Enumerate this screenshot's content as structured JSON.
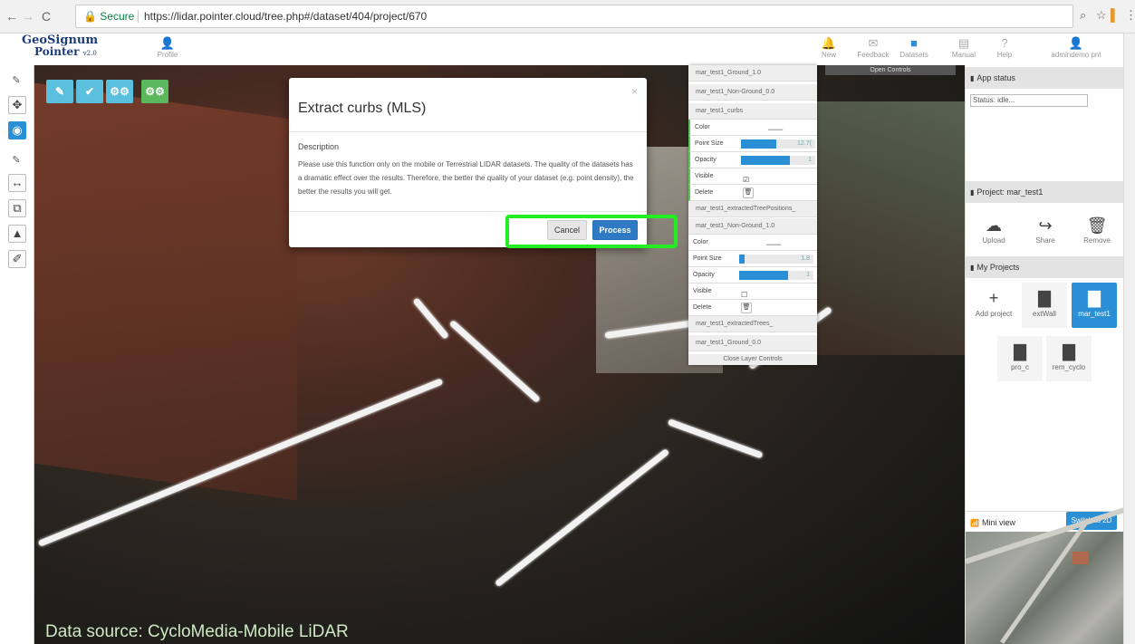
{
  "browser": {
    "secure_label": "Secure",
    "url": "https://lidar.pointer.cloud/tree.php#/dataset/404/project/670",
    "icons": [
      "back-arrow-icon",
      "forward-arrow-icon",
      "reload-icon",
      "lock-icon",
      "zoom-icon",
      "star-icon",
      "extension-icon",
      "menu-icon"
    ]
  },
  "header": {
    "logo_line1": "GeoSignum",
    "logo_line2": "Pointer",
    "logo_version": "v2.0",
    "profile_label": "Profile",
    "nav": [
      {
        "label": "New",
        "icon": "bell-icon"
      },
      {
        "label": "Feedback",
        "icon": "envelope-icon"
      },
      {
        "label": "Datasets",
        "icon": "file-icon"
      },
      {
        "label": "Manual",
        "icon": "book-icon"
      },
      {
        "label": "Help",
        "icon": "question-icon"
      },
      {
        "label": "admindemo pnt",
        "icon": "user-icon"
      }
    ],
    "open_controls": "Open Controls"
  },
  "modal": {
    "title": "Extract curbs (MLS)",
    "close": "×",
    "description_heading": "Description",
    "description": "Please use this function only on the mobile or Terrestrial LIDAR datasets. The quality of the datasets has a dramatic effect over the results. Therefore, the better the quality of your dataset (e.g. point density), the better the results you will get.",
    "cancel": "Cancel",
    "process": "Process"
  },
  "layers": {
    "rows": [
      {
        "name": "mar_test1_Ground_1.0"
      },
      {
        "name": "mar_test1_Non-Ground_0.0"
      },
      {
        "name": "mar_test1_curbs"
      }
    ],
    "curbs_props": {
      "color": "Color",
      "point_size": "Point Size",
      "point_size_value": "12.7(",
      "opacity": "Opacity",
      "opacity_value": "1",
      "visible": "Visible",
      "delete": "Delete"
    },
    "extracted_tree_positions": "mar_test1_extractedTreePositions_",
    "nonground_1": "mar_test1_Non-Ground_1.0",
    "ng_props": {
      "color": "Color",
      "point_size": "Point Size",
      "point_size_value": "1.8",
      "opacity": "Opacity",
      "opacity_value": "1",
      "visible": "Visible",
      "delete": "Delete"
    },
    "extracted_trees": "mar_test1_extractedTrees_",
    "ground_0": "mar_test1_Ground_0.0",
    "close_controls": "Close Layer Controls",
    "curbs_point_size_fraction": 0.48,
    "ng_point_size_fraction": 0.07
  },
  "sidebar": {
    "app_status_title": "App status",
    "status_value": "Status: idle...",
    "project_title": "Project: mar_test1",
    "actions": [
      {
        "label": "Upload",
        "icon": "cloud-upload-icon"
      },
      {
        "label": "Share",
        "icon": "share-icon"
      },
      {
        "label": "Remove",
        "icon": "trash-icon"
      }
    ],
    "my_projects_title": "My Projects",
    "projects": [
      {
        "label": "Add project",
        "icon": "plus-icon"
      },
      {
        "label": "extWall",
        "icon": "file-icon"
      },
      {
        "label": "mar_test1",
        "icon": "file-icon"
      },
      {
        "label": "pro_c",
        "icon": "file-icon"
      },
      {
        "label": "rem_cyclo",
        "icon": "file-icon"
      }
    ],
    "mini_view_title": "Mini view",
    "switch_2d": "Switch to 2D"
  },
  "viewer": {
    "data_source": "Data source: CycloMedia-Mobile LiDAR",
    "tool_colors": [
      "#5bc0de",
      "#5bc0de",
      "#5bc0de",
      "#5cb85c"
    ]
  },
  "colors": {
    "accent": "#2a8fd4",
    "highlight": "#22ee22",
    "process_btn": "#2f7ac4"
  }
}
